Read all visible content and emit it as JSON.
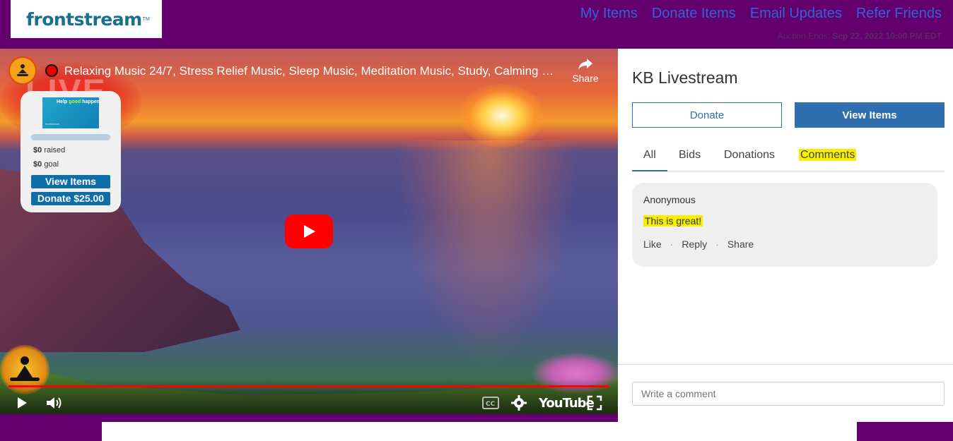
{
  "header": {
    "logo": "frontstream",
    "logo_tm": "TM",
    "nav": [
      "My Items",
      "Donate Items",
      "Email Updates",
      "Refer Friends"
    ],
    "auction_label": "Auction Ends:",
    "auction_date": "Sep 22, 2022 10:00 PM EDT"
  },
  "video": {
    "live_text": "LIVE",
    "title": "Relaxing Music 24/7, Stress Relief Music, Sleep Music, Meditation Music, Study, Calming Music",
    "share_label": "Share",
    "brand": "YouTube",
    "progress": 1.0
  },
  "widget": {
    "image_text_prefix": "Help ",
    "image_text_highlight": "good",
    "image_text_suffix": " happen",
    "image_sub": "frontstream",
    "raised_amount": "$0",
    "raised_label": "raised",
    "goal_amount": "$0",
    "goal_label": "goal",
    "view_items": "View Items",
    "donate": "Donate $25.00"
  },
  "panel": {
    "title": "KB Livestream",
    "donate_label": "Donate",
    "view_items_label": "View Items",
    "tabs": [
      "All",
      "Bids",
      "Donations",
      "Comments"
    ],
    "comment": {
      "author": "Anonymous",
      "text": "This is great!",
      "actions": [
        "Like",
        "Reply",
        "Share"
      ]
    },
    "input_placeholder": "Write a comment"
  },
  "colors": {
    "page_bg": "#64006e",
    "accent": "#2f6fb0",
    "nav_link": "#2f64d8",
    "highlight": "#f6ef00",
    "yt_red": "#ff0000"
  }
}
